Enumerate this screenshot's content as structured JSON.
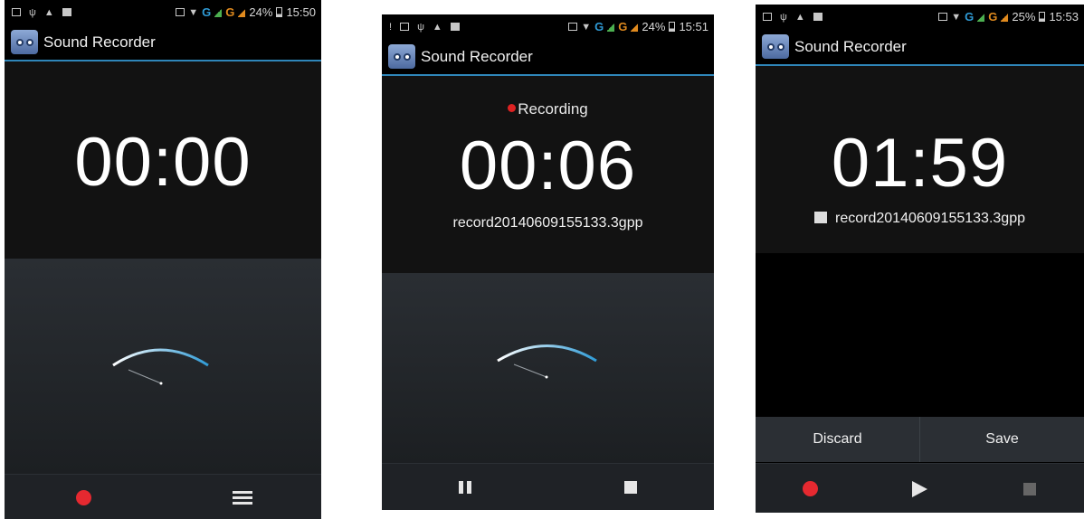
{
  "status_bar": {
    "network_letter": "G",
    "screens": [
      {
        "battery": "24%",
        "time": "15:50"
      },
      {
        "battery": "24%",
        "time": "15:51"
      },
      {
        "battery": "25%",
        "time": "15:53"
      }
    ]
  },
  "app": {
    "title": "Sound Recorder",
    "icon": "sound-recorder-app-icon"
  },
  "screens": [
    {
      "timer": "00:00",
      "controls": [
        "record",
        "recordings-list"
      ]
    },
    {
      "state": "Recording",
      "timer": "00:06",
      "filename": "record20140609155133.3gpp",
      "controls": [
        "pause",
        "stop"
      ]
    },
    {
      "timer": "01:59",
      "filename": "record20140609155133.3gpp",
      "actions": {
        "discard": "Discard",
        "save": "Save"
      },
      "controls": [
        "record",
        "play",
        "stop"
      ]
    }
  ],
  "colors": {
    "accent": "#2f86b9",
    "record_red": "#e52930",
    "meter_blue": "#2f9bd6"
  }
}
